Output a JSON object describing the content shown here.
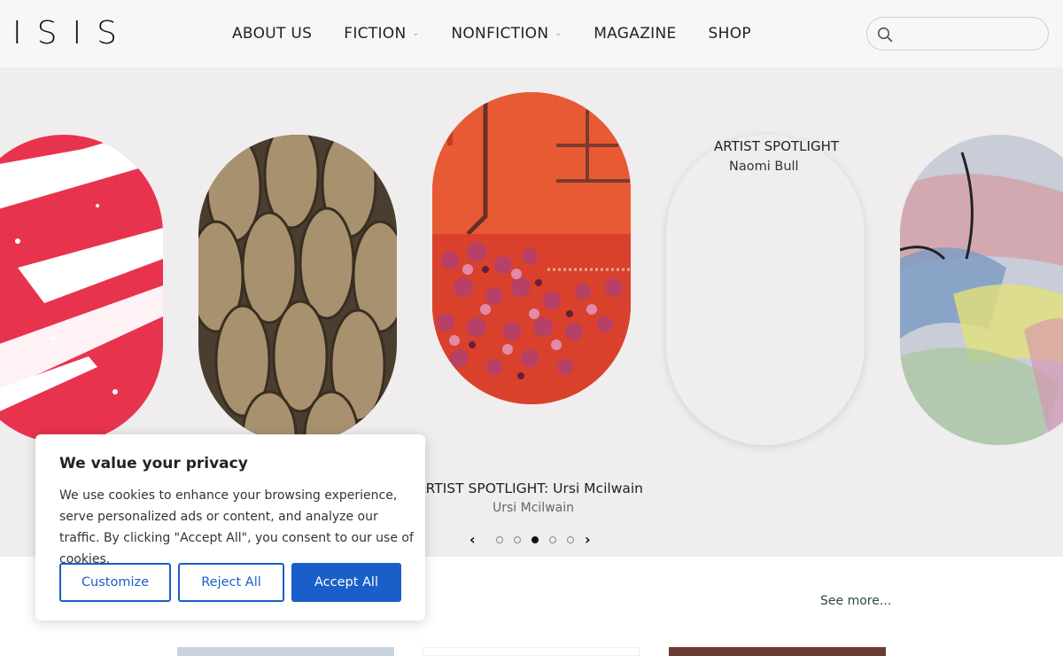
{
  "header": {
    "logo": "ISIS",
    "nav": [
      {
        "label": "ABOUT US",
        "has_dropdown": false
      },
      {
        "label": "FICTION",
        "has_dropdown": true
      },
      {
        "label": "NONFICTION",
        "has_dropdown": true
      },
      {
        "label": "MAGAZINE",
        "has_dropdown": false
      },
      {
        "label": "SHOP",
        "has_dropdown": false
      }
    ],
    "search": {
      "placeholder": "",
      "icon": "search-icon"
    }
  },
  "carousel": {
    "slide4_title": "ARTIST SPOTLIGHT",
    "slide4_sub": "Naomi Bull",
    "active_title": "ARTIST SPOTLIGHT: Ursi Mcilwain",
    "active_sub": "Ursi Mcilwain",
    "prev_icon": "chevron-left-icon",
    "next_icon": "chevron-right-icon",
    "prev_glyph": "‹",
    "next_glyph": "›",
    "dot_count": 5,
    "active_dot": 3
  },
  "section": {
    "see_more": "See more..."
  },
  "cookie": {
    "title": "We value your privacy",
    "text": "We use cookies to enhance your browsing experience, serve personalized ads or content, and analyze our traffic. By clicking \"Accept All\", you consent to our use of cookies.",
    "customize": "Customize",
    "reject": "Reject All",
    "accept": "Accept All"
  },
  "colors": {
    "accent": "#1a5ec9",
    "header_bg": "#f7f7f8",
    "carousel_bg": "#efeded"
  }
}
